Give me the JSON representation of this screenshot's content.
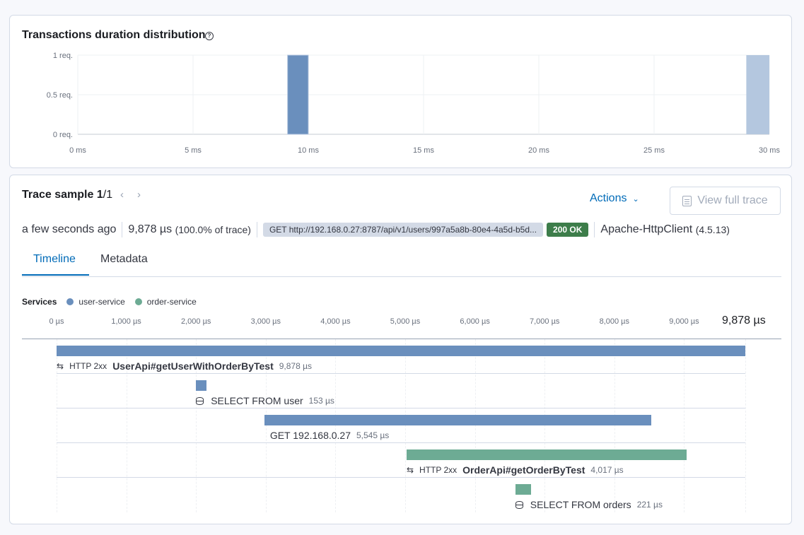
{
  "distribution": {
    "title": "Transactions duration distribution",
    "help_icon": "question-circle-icon",
    "chart_data": {
      "type": "bar",
      "xlabel": "",
      "ylabel": "",
      "x_ticks": [
        "0 ms",
        "5 ms",
        "10 ms",
        "15 ms",
        "20 ms",
        "25 ms",
        "30 ms"
      ],
      "y_ticks": [
        "0 req.",
        "0.5 req.",
        "1 req."
      ],
      "xlim": [
        0,
        30
      ],
      "ylim": [
        0,
        1
      ],
      "grid": true,
      "bars": [
        {
          "x_start": 9.1,
          "x_end": 10.0,
          "value": 1,
          "selected": true
        },
        {
          "x_start": 29.0,
          "x_end": 30.0,
          "value": 1,
          "selected": false
        }
      ],
      "colors": {
        "selected": "#6a8fbd",
        "unselected": "#b4c7df"
      }
    }
  },
  "trace": {
    "title": "Trace sample",
    "position": "1",
    "count": "/1",
    "prev_icon": "chevron-left-icon",
    "next_icon": "chevron-right-icon",
    "actions_label": "Actions",
    "view_full_trace_label": "View full trace",
    "timestamp": "a few seconds ago",
    "duration": "9,878 µs",
    "duration_pct": "(100.0% of trace)",
    "url": "GET http://192.168.0.27:8787/api/v1/users/997a5a8b-80e4-4a5d-b5d...",
    "status": "200 OK",
    "status_color": "#3d7d4a",
    "user_agent": "Apache-HttpClient",
    "user_agent_version": "(4.5.13)",
    "tabs": [
      {
        "label": "Timeline",
        "active": true
      },
      {
        "label": "Metadata",
        "active": false
      }
    ],
    "services_label": "Services",
    "services": [
      {
        "name": "user-service",
        "color": "#6a8fbd"
      },
      {
        "name": "order-service",
        "color": "#6dab94"
      }
    ],
    "timeline_ticks": [
      "0 µs",
      "1,000 µs",
      "2,000 µs",
      "3,000 µs",
      "4,000 µs",
      "5,000 µs",
      "6,000 µs",
      "7,000 µs",
      "8,000 µs",
      "9,000 µs"
    ],
    "timeline_total": "9,878 µs",
    "total_us": 9878,
    "spans": [
      {
        "icon": "http-arrows-icon",
        "http": "HTTP 2xx",
        "name": "UserApi#getUserWithOrderByTest",
        "bold": true,
        "duration": "9,878 µs",
        "start_us": 0,
        "duration_us": 9878,
        "service": "user-service"
      },
      {
        "icon": "database-icon",
        "http": "",
        "name": "SELECT FROM user",
        "bold": false,
        "duration": "153 µs",
        "start_us": 2000,
        "duration_us": 153,
        "service": "user-service"
      },
      {
        "icon": "",
        "http": "",
        "name": "GET 192.168.0.27",
        "bold": false,
        "duration": "5,545 µs",
        "start_us": 2980,
        "duration_us": 5545,
        "service": "user-service"
      },
      {
        "icon": "http-arrows-icon",
        "http": "HTTP 2xx",
        "name": "OrderApi#getOrderByTest",
        "bold": true,
        "duration": "4,017 µs",
        "start_us": 5020,
        "duration_us": 4017,
        "service": "order-service"
      },
      {
        "icon": "database-icon",
        "http": "",
        "name": "SELECT FROM orders",
        "bold": false,
        "duration": "221 µs",
        "start_us": 6580,
        "duration_us": 221,
        "service": "order-service"
      }
    ]
  }
}
